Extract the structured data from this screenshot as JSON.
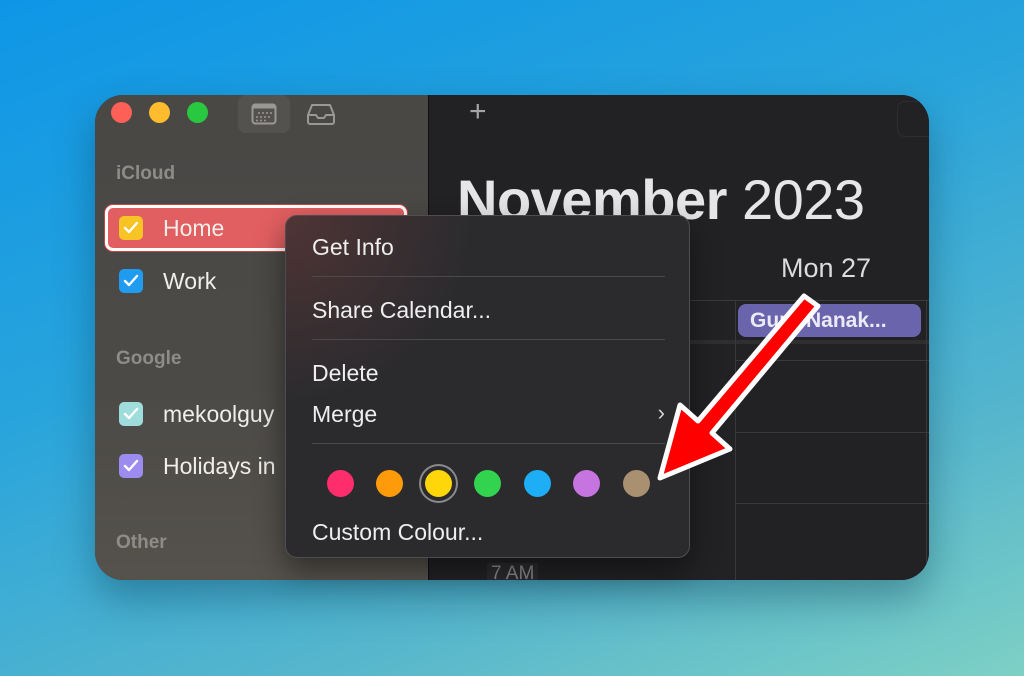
{
  "toolbar": {
    "calendar_view_icon": "calendar-grid-icon",
    "inbox_icon": "inbox-tray-icon",
    "add_icon": "+"
  },
  "sidebar": {
    "sections": [
      {
        "label": "iCloud",
        "items": [
          {
            "label": "Home",
            "color": "#f7c325",
            "checked": true,
            "selected": true
          },
          {
            "label": "Work",
            "color": "#1f9bf0",
            "checked": true,
            "selected": false
          }
        ]
      },
      {
        "label": "Google",
        "items": [
          {
            "label": "mekoolguy",
            "color": "#9fdcdc",
            "checked": true,
            "selected": false
          },
          {
            "label": "Holidays in",
            "color": "#9d8cf0",
            "checked": true,
            "selected": false
          }
        ]
      },
      {
        "label": "Other",
        "items": []
      }
    ]
  },
  "calendar": {
    "month": "November",
    "year": "2023",
    "day_header": "Mon 27",
    "allday_event": {
      "title": "Guru Nanak...",
      "color": "#6a64ac"
    },
    "time_label": "7 AM"
  },
  "context_menu": {
    "items": [
      {
        "label": "Get Info"
      },
      {
        "label": "Share Calendar..."
      },
      {
        "label": "Delete"
      },
      {
        "label": "Merge",
        "submenu": true
      },
      {
        "label": "Custom Colour..."
      }
    ],
    "colors": [
      {
        "name": "red",
        "hex": "#ff2d6b",
        "selected": false
      },
      {
        "name": "orange",
        "hex": "#ff9a0a",
        "selected": false
      },
      {
        "name": "yellow",
        "hex": "#ffd60a",
        "selected": true
      },
      {
        "name": "green",
        "hex": "#32d34f",
        "selected": false
      },
      {
        "name": "blue",
        "hex": "#1daef5",
        "selected": false
      },
      {
        "name": "purple",
        "hex": "#c674e0",
        "selected": false
      },
      {
        "name": "brown",
        "hex": "#a99070",
        "selected": false
      }
    ],
    "submenu_icon": "›"
  },
  "annotation": {
    "type": "arrow",
    "color": "#ff0000",
    "outline": "#ffffff"
  }
}
